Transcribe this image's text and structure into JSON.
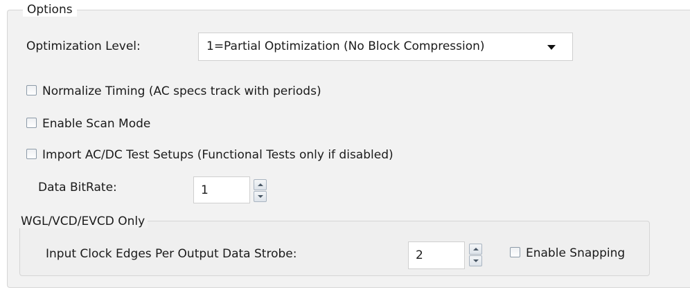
{
  "options": {
    "legend": "Options",
    "optimization_label": "Optimization Level:",
    "optimization_value": "1=Partial Optimization (No Block Compression)",
    "normalize_timing_label": "Normalize Timing (AC specs track with periods)",
    "enable_scan_label": "Enable Scan Mode",
    "import_acdc_label": "Import AC/DC Test Setups  (Functional Tests only if disabled)",
    "data_bitrate_label": "Data BitRate:",
    "data_bitrate_value": "1"
  },
  "wgl": {
    "legend": "WGL/VCD/EVCD Only",
    "clock_edges_label": "Input Clock Edges Per Output Data Strobe:",
    "clock_edges_value": "2",
    "enable_snapping_label": "Enable Snapping"
  }
}
